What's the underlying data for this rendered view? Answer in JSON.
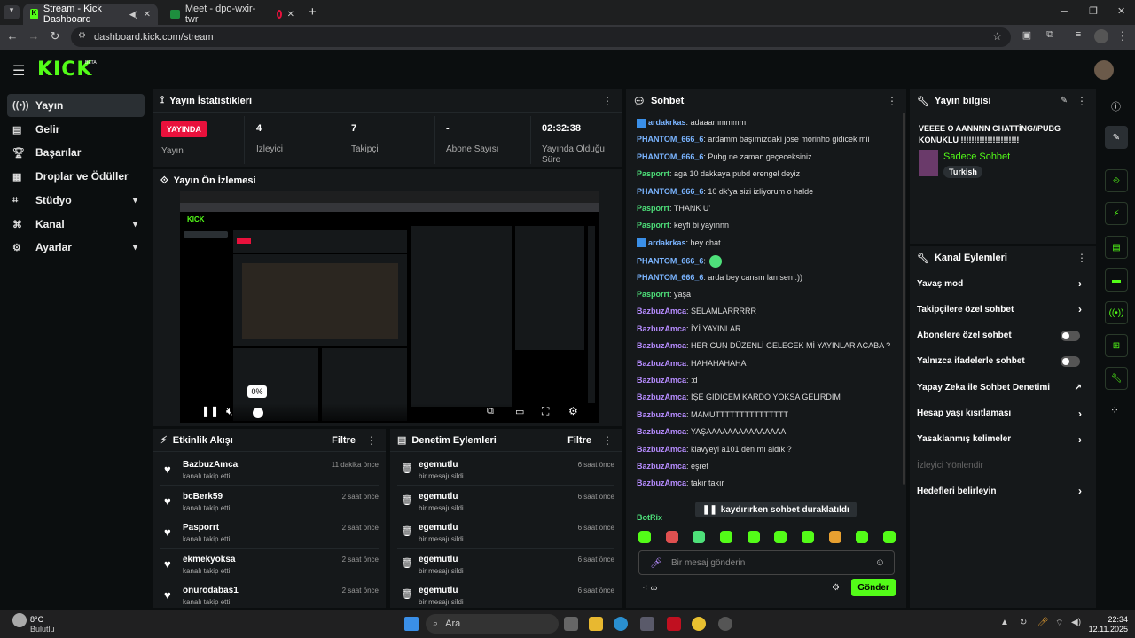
{
  "browser": {
    "tabs": [
      {
        "label": "Stream - Kick Dashboard",
        "active": true
      },
      {
        "label": "Meet - dpo-wxir-twr",
        "active": false
      },
      {
        "label": "",
        "active": false
      }
    ],
    "new_tab": "+",
    "url": "dashboard.kick.com/stream"
  },
  "header": {
    "logo": "KICK",
    "beta": "BETA"
  },
  "sidebar": {
    "items": [
      {
        "label": "Yayın",
        "icon": "broadcast-icon"
      },
      {
        "label": "Gelir",
        "icon": "revenue-icon"
      },
      {
        "label": "Başarılar",
        "icon": "trophy-icon"
      },
      {
        "label": "Droplar ve Ödüller",
        "icon": "gift-icon"
      },
      {
        "label": "Stüdyo",
        "icon": "studio-icon"
      },
      {
        "label": "Kanal",
        "icon": "channel-icon"
      },
      {
        "label": "Ayarlar",
        "icon": "gear-icon"
      }
    ]
  },
  "stats": {
    "title": "Yayın İstatistikleri",
    "live_badge": "YAYINDA",
    "live_label": "Yayın",
    "viewers_value": "4",
    "viewers_label": "İzleyici",
    "followers_value": "7",
    "followers_label": "Takipçi",
    "subs_value": "-",
    "subs_label": "Abone Sayısı",
    "duration_value": "02:32:38",
    "duration_label": "Yayında Olduğu Süre"
  },
  "preview": {
    "title": "Yayın Ön İzlemesi",
    "volume": "0%"
  },
  "activity": {
    "title": "Etkinlik Akışı",
    "filter": "Filtre",
    "items": [
      {
        "user": "BazbuzAmca",
        "action": "kanalı takip etti",
        "time": "11 dakika önce"
      },
      {
        "user": "bcBerk59",
        "action": "kanalı takip etti",
        "time": "2 saat önce"
      },
      {
        "user": "Pasporrt",
        "action": "kanalı takip etti",
        "time": "2 saat önce"
      },
      {
        "user": "ekmekyoksa",
        "action": "kanalı takip etti",
        "time": "2 saat önce"
      },
      {
        "user": "onurodabas1",
        "action": "kanalı takip etti",
        "time": "2 saat önce"
      }
    ]
  },
  "moderation": {
    "title": "Denetim Eylemleri",
    "filter": "Filtre",
    "items": [
      {
        "user": "egemutlu",
        "action": "bir mesajı sildi",
        "time": "6 saat önce"
      },
      {
        "user": "egemutlu",
        "action": "bir mesajı sildi",
        "time": "6 saat önce"
      },
      {
        "user": "egemutlu",
        "action": "bir mesajı sildi",
        "time": "6 saat önce"
      },
      {
        "user": "egemutlu",
        "action": "bir mesajı sildi",
        "time": "6 saat önce"
      },
      {
        "user": "egemutlu",
        "action": "bir mesajı sildi",
        "time": "6 saat önce"
      }
    ]
  },
  "chat": {
    "title": "Sohbet",
    "messages": [
      {
        "user": "ardakrkas",
        "color": "blue",
        "text": ": adaaammmmm"
      },
      {
        "user": "PHANTOM_666_6",
        "color": "blue",
        "text": ": ardamm başımızdaki jose morinho gidicek mii"
      },
      {
        "user": "PHANTOM_666_6",
        "color": "blue",
        "text": ": Pubg ne zaman geçeceksiniz"
      },
      {
        "user": "Pasporrt",
        "color": "green",
        "text": ": aga 10 dakkaya pubd erengel deyiz"
      },
      {
        "user": "PHANTOM_666_6",
        "color": "blue",
        "text": ": 10 dk'ya sizi izliyorum o halde"
      },
      {
        "user": "Pasporrt",
        "color": "green",
        "text": ": THANK U'"
      },
      {
        "user": "Pasporrt",
        "color": "green",
        "text": ": keyfi bi yayınnn"
      },
      {
        "user": "ardakrkas",
        "color": "blue",
        "text": ": hey chat"
      },
      {
        "user": "PHANTOM_666_6",
        "color": "blue",
        "text": ": "
      },
      {
        "user": "PHANTOM_666_6",
        "color": "blue",
        "text": ": arda bey cansın lan sen :))"
      },
      {
        "user": "Pasporrt",
        "color": "green",
        "text": ": yaşa"
      },
      {
        "user": "BazbuzAmca",
        "color": "purple",
        "text": ": SELAMLARRRRR"
      },
      {
        "user": "BazbuzAmca",
        "color": "purple",
        "text": ": İYİ YAYINLAR"
      },
      {
        "user": "BazbuzAmca",
        "color": "purple",
        "text": ": HER GUN DÜZENLİ GELECEK Mİ YAYINLAR ACABA ?"
      },
      {
        "user": "BazbuzAmca",
        "color": "purple",
        "text": ": HAHAHAHAHA"
      },
      {
        "user": "BazbuzAmca",
        "color": "purple",
        "text": ": :d"
      },
      {
        "user": "BazbuzAmca",
        "color": "purple",
        "text": ": İŞE GİDİCEM KARDO YOKSA GELİRDİM"
      },
      {
        "user": "BazbuzAmca",
        "color": "purple",
        "text": ": MAMUTTTTTTTTTTTTTTT"
      },
      {
        "user": "BazbuzAmca",
        "color": "purple",
        "text": ": YAŞAAAAAAAAAAAAAAA"
      },
      {
        "user": "BazbuzAmca",
        "color": "purple",
        "text": ": klavyeyi a101 den mı aldık ?"
      },
      {
        "user": "BazbuzAmca",
        "color": "purple",
        "text": ": eşref"
      },
      {
        "user": "BazbuzAmca",
        "color": "purple",
        "text": ": takır takır"
      }
    ],
    "paused_notice": "kaydırırken sohbet duraklatıldı",
    "last_user": "BotRix",
    "input_placeholder": "Bir mesaj gönderin",
    "send": "Gönder"
  },
  "stream_info": {
    "title": "Yayın bilgisi",
    "stream_title": "VEEEE O AANNNN CHATTİNG//PUBG KONUKLU !!!!!!!!!!!!!!!!!!!!!!",
    "category": "Sadece Sohbet",
    "tag": "Turkish"
  },
  "channel_actions": {
    "title": "Kanal Eylemleri",
    "items": [
      {
        "label": "Yavaş mod",
        "control": "chevron"
      },
      {
        "label": "Takipçilere özel sohbet",
        "control": "chevron"
      },
      {
        "label": "Abonelere özel sohbet",
        "control": "toggle"
      },
      {
        "label": "Yalnızca ifadelerle sohbet",
        "control": "toggle"
      },
      {
        "label": "Yapay Zeka ile Sohbet Denetimi",
        "control": "external"
      },
      {
        "label": "Hesap yaşı kısıtlaması",
        "control": "chevron"
      },
      {
        "label": "Yasaklanmış kelimeler",
        "control": "chevron"
      },
      {
        "label": "İzleyici Yönlendir",
        "control": "disabled"
      },
      {
        "label": "Hedefleri belirleyin",
        "control": "chevron"
      }
    ]
  },
  "taskbar": {
    "weather_temp": "8°C",
    "weather_desc": "Bulutlu",
    "search": "Ara",
    "time": "22:34",
    "date": "12.11.2025"
  },
  "colors": {
    "accent": "#53fc18",
    "live": "#e9113c",
    "bg": "#0b0e0f",
    "panel": "#15181a"
  }
}
